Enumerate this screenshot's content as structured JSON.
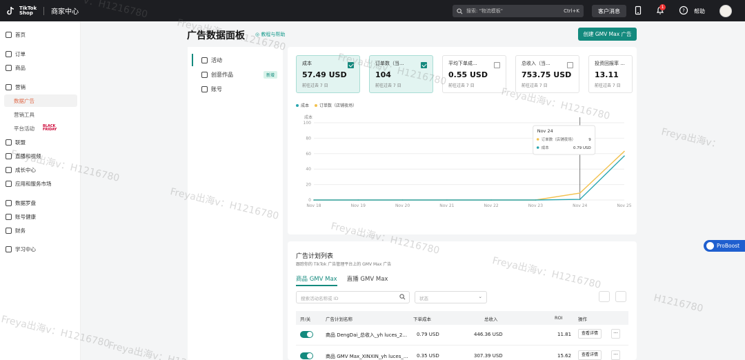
{
  "topbar": {
    "logo_line1": "TikTok",
    "logo_line2": "Shop",
    "logo_sub": "商家中心",
    "search_placeholder": "搜索: \"物流模板\"",
    "search_shortcut": "Ctrl+K",
    "customer_service": "客户消息",
    "notification_count": "1",
    "help": "帮助"
  },
  "sidebar": {
    "items": [
      {
        "label": "首页"
      },
      {
        "label": "订单"
      },
      {
        "label": "商品"
      },
      {
        "label": "营销"
      },
      {
        "label": "数据广告"
      },
      {
        "label": "营销工具"
      },
      {
        "label": "平台活动"
      },
      {
        "label": "联盟"
      },
      {
        "label": "直播和视频"
      },
      {
        "label": "成长中心"
      },
      {
        "label": "应用和服务市场"
      },
      {
        "label": "数据罗盘"
      },
      {
        "label": "账号健康"
      },
      {
        "label": "财务"
      },
      {
        "label": "学习中心"
      }
    ],
    "bf_tag_line1": "BLACK",
    "bf_tag_line2": "FRIDAY"
  },
  "header": {
    "title": "广告数据面板",
    "help_link": "教程与帮助",
    "create_button": "创建 GMV Max 广告"
  },
  "submenu": {
    "items": [
      {
        "label": "活动"
      },
      {
        "label": "创意作品",
        "tag": "新增"
      },
      {
        "label": "账号"
      }
    ]
  },
  "metrics": [
    {
      "label": "成本",
      "value": "57.49 USD",
      "period": "前往过去 7 日",
      "selected": true
    },
    {
      "label": "订单数（当...",
      "value": "104",
      "period": "前往过去 7 日",
      "selected": true
    },
    {
      "label": "平均下单成...",
      "value": "0.55 USD",
      "period": "前往过去 7 日",
      "selected": false
    },
    {
      "label": "总收入（当...",
      "value": "753.75 USD",
      "period": "前往过去 7 日",
      "selected": false
    },
    {
      "label": "投资回报率 ...",
      "value": "13.11",
      "period": "前往过去 7 日",
      "selected": false
    }
  ],
  "chart_data": {
    "type": "line",
    "categories": [
      "Nov 18",
      "Nov 19",
      "Nov 20",
      "Nov 21",
      "Nov 22",
      "Nov 23",
      "Nov 24",
      "Nov 25"
    ],
    "series": [
      {
        "name": "订单数（店铺夜场）",
        "color": "#f2c14e",
        "values": [
          0,
          0,
          0,
          0,
          0,
          0,
          9,
          63
        ]
      },
      {
        "name": "成本",
        "color": "#2aa6b0",
        "values": [
          0,
          0,
          0,
          0,
          0,
          0,
          0.79,
          57
        ]
      }
    ],
    "ylabel": "成本",
    "yticks": [
      "0",
      "20",
      "40",
      "60",
      "80",
      "100"
    ],
    "ylim": [
      0,
      100
    ],
    "legend": [
      "成本",
      "订单数（店铺夜场）"
    ],
    "grid": true,
    "tooltip": {
      "title": "Nov 24",
      "rows": [
        {
          "label": "订单数（店铺夜场）",
          "value": "9"
        },
        {
          "label": "成本",
          "value": "0.79 USD"
        }
      ]
    }
  },
  "plan": {
    "title": "广告计划列表",
    "desc": "跟踪你的 TikTok 广告管理平台上的 GMV Max 广告",
    "tabs": [
      "商品 GMV Max",
      "直播 GMV Max"
    ],
    "search_placeholder": "搜索活动名称或 ID",
    "status_placeholder": "状态",
    "columns": [
      "开/关",
      "广告计划名称",
      "下单成本",
      "总收入",
      "ROI",
      "操作"
    ],
    "rows": [
      {
        "name": "商品 DengDai_总收入_yh luces_2...",
        "cost": "0.79 USD",
        "revenue": "446.36 USD",
        "roi": "11.81",
        "action": "查看详情"
      },
      {
        "name": "商品 GMV Max_XINXIN_yh luces_...",
        "cost": "0.35 USD",
        "revenue": "307.39 USD",
        "roi": "15.62",
        "action": "查看详情"
      }
    ],
    "more": "···"
  },
  "proboost": "ProBoost",
  "watermarks": [
    "Freya出海v：H1216780",
    "Freya出海v：H1216780",
    "Freya出海v：H1216780",
    "Freya出海v：H1216780",
    "Freya出海v：H1216780",
    "Freya出海v：H1216780",
    "Freya出海v：H1216780",
    "Freya出海v：H1216780",
    "Freya出海v：H1216780",
    "v：H1216780",
    "Freya出海v：",
    "Freya出海v：H1216780",
    "H1216780"
  ]
}
